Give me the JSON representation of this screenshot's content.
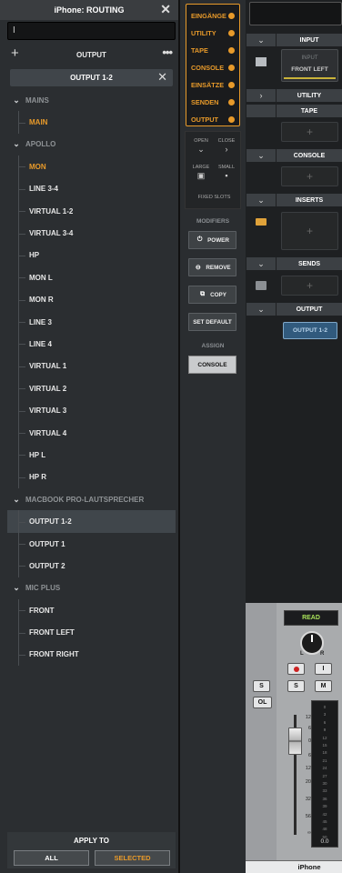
{
  "routing": {
    "title": "iPhone: ROUTING",
    "search_value": "I",
    "section_label": "OUTPUT",
    "current_output": "OUTPUT 1-2",
    "tree": [
      {
        "kind": "group",
        "label": "MAINS"
      },
      {
        "kind": "item",
        "label": "MAIN",
        "state": "active"
      },
      {
        "kind": "group",
        "label": "APOLLO"
      },
      {
        "kind": "item",
        "label": "MON",
        "state": "active"
      },
      {
        "kind": "item",
        "label": "LINE 3-4"
      },
      {
        "kind": "item",
        "label": "VIRTUAL 1-2"
      },
      {
        "kind": "item",
        "label": "VIRTUAL 3-4"
      },
      {
        "kind": "item",
        "label": "HP"
      },
      {
        "kind": "item",
        "label": "MON L"
      },
      {
        "kind": "item",
        "label": "MON R"
      },
      {
        "kind": "item",
        "label": "LINE 3"
      },
      {
        "kind": "item",
        "label": "LINE 4"
      },
      {
        "kind": "item",
        "label": "VIRTUAL 1"
      },
      {
        "kind": "item",
        "label": "VIRTUAL 2"
      },
      {
        "kind": "item",
        "label": "VIRTUAL 3"
      },
      {
        "kind": "item",
        "label": "VIRTUAL 4"
      },
      {
        "kind": "item",
        "label": "HP L"
      },
      {
        "kind": "item",
        "label": "HP R"
      },
      {
        "kind": "group",
        "label": "MACBOOK PRO-LAUTSPRECHER"
      },
      {
        "kind": "item",
        "label": "OUTPUT 1-2",
        "state": "selected"
      },
      {
        "kind": "item",
        "label": "OUTPUT 1"
      },
      {
        "kind": "item",
        "label": "OUTPUT 2"
      },
      {
        "kind": "group",
        "label": "MIC PLUS"
      },
      {
        "kind": "item",
        "label": "FRONT"
      },
      {
        "kind": "item",
        "label": "FRONT LEFT"
      },
      {
        "kind": "item",
        "label": "FRONT RIGHT"
      }
    ],
    "apply_to": {
      "title": "APPLY TO",
      "all": "ALL",
      "selected": "SELECTED"
    }
  },
  "categories": [
    "EINGÄNGE",
    "UTILITY",
    "TAPE",
    "CONSOLE",
    "EINSÄTZE",
    "SENDEN",
    "OUTPUT"
  ],
  "view": {
    "open": "OPEN",
    "close": "CLOSE",
    "large": "LARGE",
    "small": "SMALL",
    "fixed_slots": "FIXED SLOTS"
  },
  "modifiers": {
    "title": "MODIFIERS",
    "power": "POWER",
    "remove": "REMOVE",
    "copy": "COPY",
    "set_default": "SET DEFAULT"
  },
  "assign": {
    "title": "ASSIGN",
    "console": "CONSOLE"
  },
  "strip": {
    "sections": {
      "input": "INPUT",
      "utility": "UTILITY",
      "tape": "TAPE",
      "console": "CONSOLE",
      "inserts": "INSERTS",
      "sends": "SENDS",
      "output": "OUTPUT"
    },
    "input_label": "INPUT",
    "input_source": "FRONT LEFT",
    "output_assignment": "OUTPUT 1-2",
    "automation": "READ",
    "pan_left": "L",
    "pan_right": "R",
    "solo": "S",
    "ol": "OL",
    "s_btn": "S",
    "m_btn": "M",
    "i_btn": "I",
    "meter_ticks": [
      "0",
      "3",
      "6",
      "9",
      "12",
      "15",
      "18",
      "21",
      "24",
      "27",
      "30",
      "33",
      "36",
      "39",
      "42",
      "45",
      "48",
      "50"
    ],
    "fader_scale": [
      "12",
      "6",
      "0",
      "6",
      "12",
      "20",
      "32",
      "56",
      "∞"
    ],
    "peak_value": "0.0",
    "channel_name": "iPhone"
  }
}
